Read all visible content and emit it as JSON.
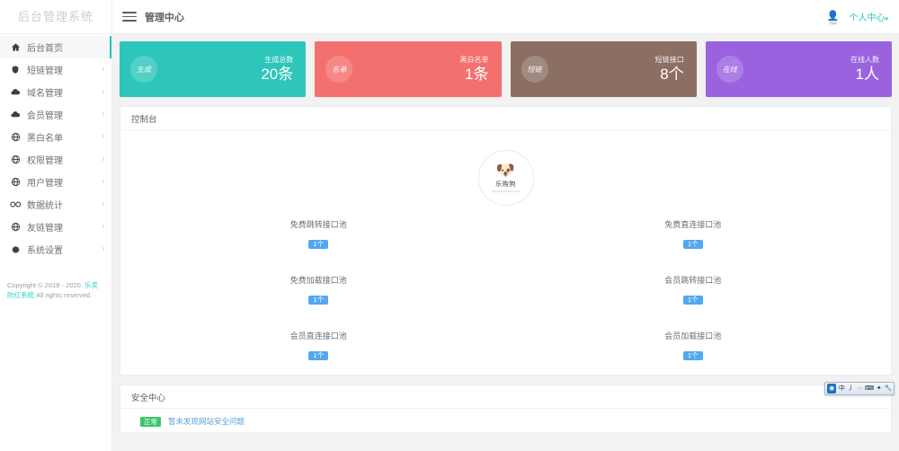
{
  "sidebar": {
    "title": "后台管理系统",
    "items": [
      {
        "label": "后台首页",
        "icon": "home-icon",
        "active": true,
        "arrow": false
      },
      {
        "label": "短链管理",
        "icon": "shield-icon",
        "active": false,
        "arrow": true
      },
      {
        "label": "域名管理",
        "icon": "cloud-icon",
        "active": false,
        "arrow": true
      },
      {
        "label": "会员管理",
        "icon": "cloud-icon",
        "active": false,
        "arrow": true
      },
      {
        "label": "黑白名单",
        "icon": "globe-icon",
        "active": false,
        "arrow": true
      },
      {
        "label": "权限管理",
        "icon": "globe-icon",
        "active": false,
        "arrow": true
      },
      {
        "label": "用户管理",
        "icon": "globe-icon",
        "active": false,
        "arrow": true
      },
      {
        "label": "数据统计",
        "icon": "infinity-icon",
        "active": false,
        "arrow": true
      },
      {
        "label": "友链管理",
        "icon": "globe-icon",
        "active": false,
        "arrow": true
      },
      {
        "label": "系统设置",
        "icon": "gear-icon",
        "active": false,
        "arrow": true
      }
    ],
    "copyright_prefix": "Copyright © 2018 - 2020. ",
    "copyright_link": "乐卖防红系统",
    "copyright_suffix": " All rights reserved."
  },
  "topbar": {
    "title": "管理中心",
    "user_menu": "个人中心",
    "caret": "▾",
    "avatar_glyph": "👤",
    "avatar_caption": "乐购狗"
  },
  "cards": [
    {
      "tag": "生成",
      "label": "生成总数",
      "value": "20条",
      "color": "#2ec6bb"
    },
    {
      "tag": "名单",
      "label": "黑白名单",
      "value": "1条",
      "color": "#f4706e"
    },
    {
      "tag": "短链",
      "label": "短链接口",
      "value": "8个",
      "color": "#8c6f63"
    },
    {
      "tag": "在线",
      "label": "在线人数",
      "value": "1人",
      "color": "#9b62e0"
    }
  ],
  "console": {
    "panel_title": "控制台",
    "brand": {
      "face": "🐶",
      "name": "乐购狗",
      "url": "WWW.LEGOUGOU.COM"
    },
    "pools": [
      {
        "label": "免费跳转接口池",
        "count": "1个"
      },
      {
        "label": "免费直连接口池",
        "count": "1个"
      },
      {
        "label": "免费加载接口池",
        "count": "1个"
      },
      {
        "label": "会员跳转接口池",
        "count": "1个"
      },
      {
        "label": "会员直连接口池",
        "count": "1个"
      },
      {
        "label": "会员加载接口池",
        "count": "1个"
      }
    ]
  },
  "security": {
    "panel_title": "安全中心",
    "status_badge": "正常",
    "status_text": "暂未发现网站安全问题"
  },
  "ime": {
    "buttons": [
      "中",
      "丿",
      "··",
      "⌨",
      "✦",
      "🔧"
    ],
    "logo": "◉"
  }
}
